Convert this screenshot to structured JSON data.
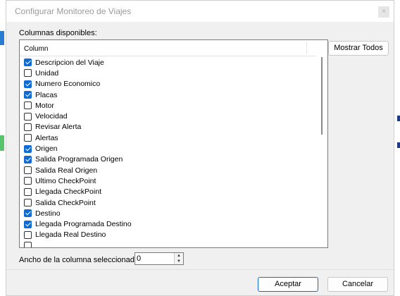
{
  "window": {
    "title": "Configurar Monitoreo de Viajes",
    "close_glyph": "×"
  },
  "columns_label": "Columnas disponibles:",
  "list": {
    "header": "Column",
    "items": [
      {
        "label": "Descripcion del Viaje",
        "checked": true
      },
      {
        "label": "Unidad",
        "checked": false
      },
      {
        "label": "Numero Economico",
        "checked": true
      },
      {
        "label": "Placas",
        "checked": true
      },
      {
        "label": "Motor",
        "checked": false
      },
      {
        "label": "Velocidad",
        "checked": false
      },
      {
        "label": "Revisar Alerta",
        "checked": false
      },
      {
        "label": "Alertas",
        "checked": false
      },
      {
        "label": "Origen",
        "checked": true
      },
      {
        "label": "Salida Programada Origen",
        "checked": true
      },
      {
        "label": "Salida Real Origen",
        "checked": false
      },
      {
        "label": "Ultimo CheckPoint",
        "checked": false
      },
      {
        "label": "Llegada CheckPoint",
        "checked": false
      },
      {
        "label": "Salida CheckPoint",
        "checked": false
      },
      {
        "label": "Destino",
        "checked": true
      },
      {
        "label": "Llegada Programada Destino",
        "checked": true
      },
      {
        "label": "Llegada Real Destino",
        "checked": false
      },
      {
        "label": "",
        "checked": false
      }
    ]
  },
  "buttons": {
    "show_all": "Mostrar Todos",
    "accept": "Aceptar",
    "cancel": "Cancelar"
  },
  "column_width": {
    "label": "Ancho de la columna seleccionada:",
    "value": "0"
  },
  "colors": {
    "checked": "#0f6cd6",
    "accent_border": "#0f6cd6"
  }
}
